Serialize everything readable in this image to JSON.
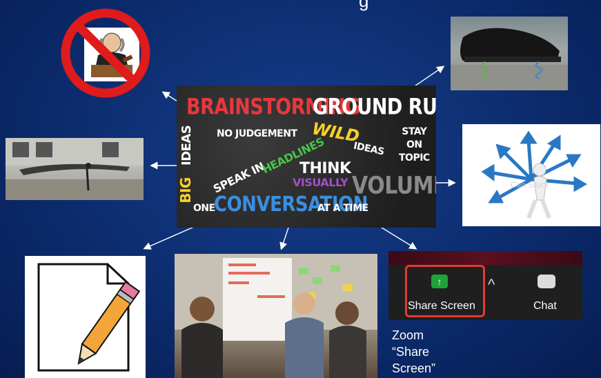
{
  "title_fragment": "g",
  "poster": {
    "brainstorming": "BRAINSTORMING",
    "ground_rules": "GROUND RULES",
    "no_judgement": "NO JUDGEMENT",
    "wild": "WILD",
    "ideas_wild": "IDEAS",
    "stay_on_topic": "STAY\nON\nTOPIC",
    "big": "BIG",
    "ideas_big": "IDEAS",
    "speak_in": "SPEAK IN",
    "headlines": "HEADLINES",
    "think": "THINK",
    "visually": "VISUALLY",
    "volume": "VOLUME",
    "one": "ONE",
    "conversation": "CONVERSATION",
    "at_a_time": "AT A TIME"
  },
  "zoom": {
    "share_screen": "Share Screen",
    "chat": "Chat",
    "caption": "Zoom “Share Screen”"
  },
  "colors": {
    "background": "#0b2a6b",
    "prohibit_red": "#e01b1b",
    "brainstorming_red": "#e8383d",
    "wild_yellow": "#f5d02a",
    "headlines_green": "#49c44a",
    "visually_purple": "#a64cc9",
    "conversation_blue": "#3a8fe0",
    "share_green": "#1fa23a"
  },
  "watermark": "Can Stock"
}
